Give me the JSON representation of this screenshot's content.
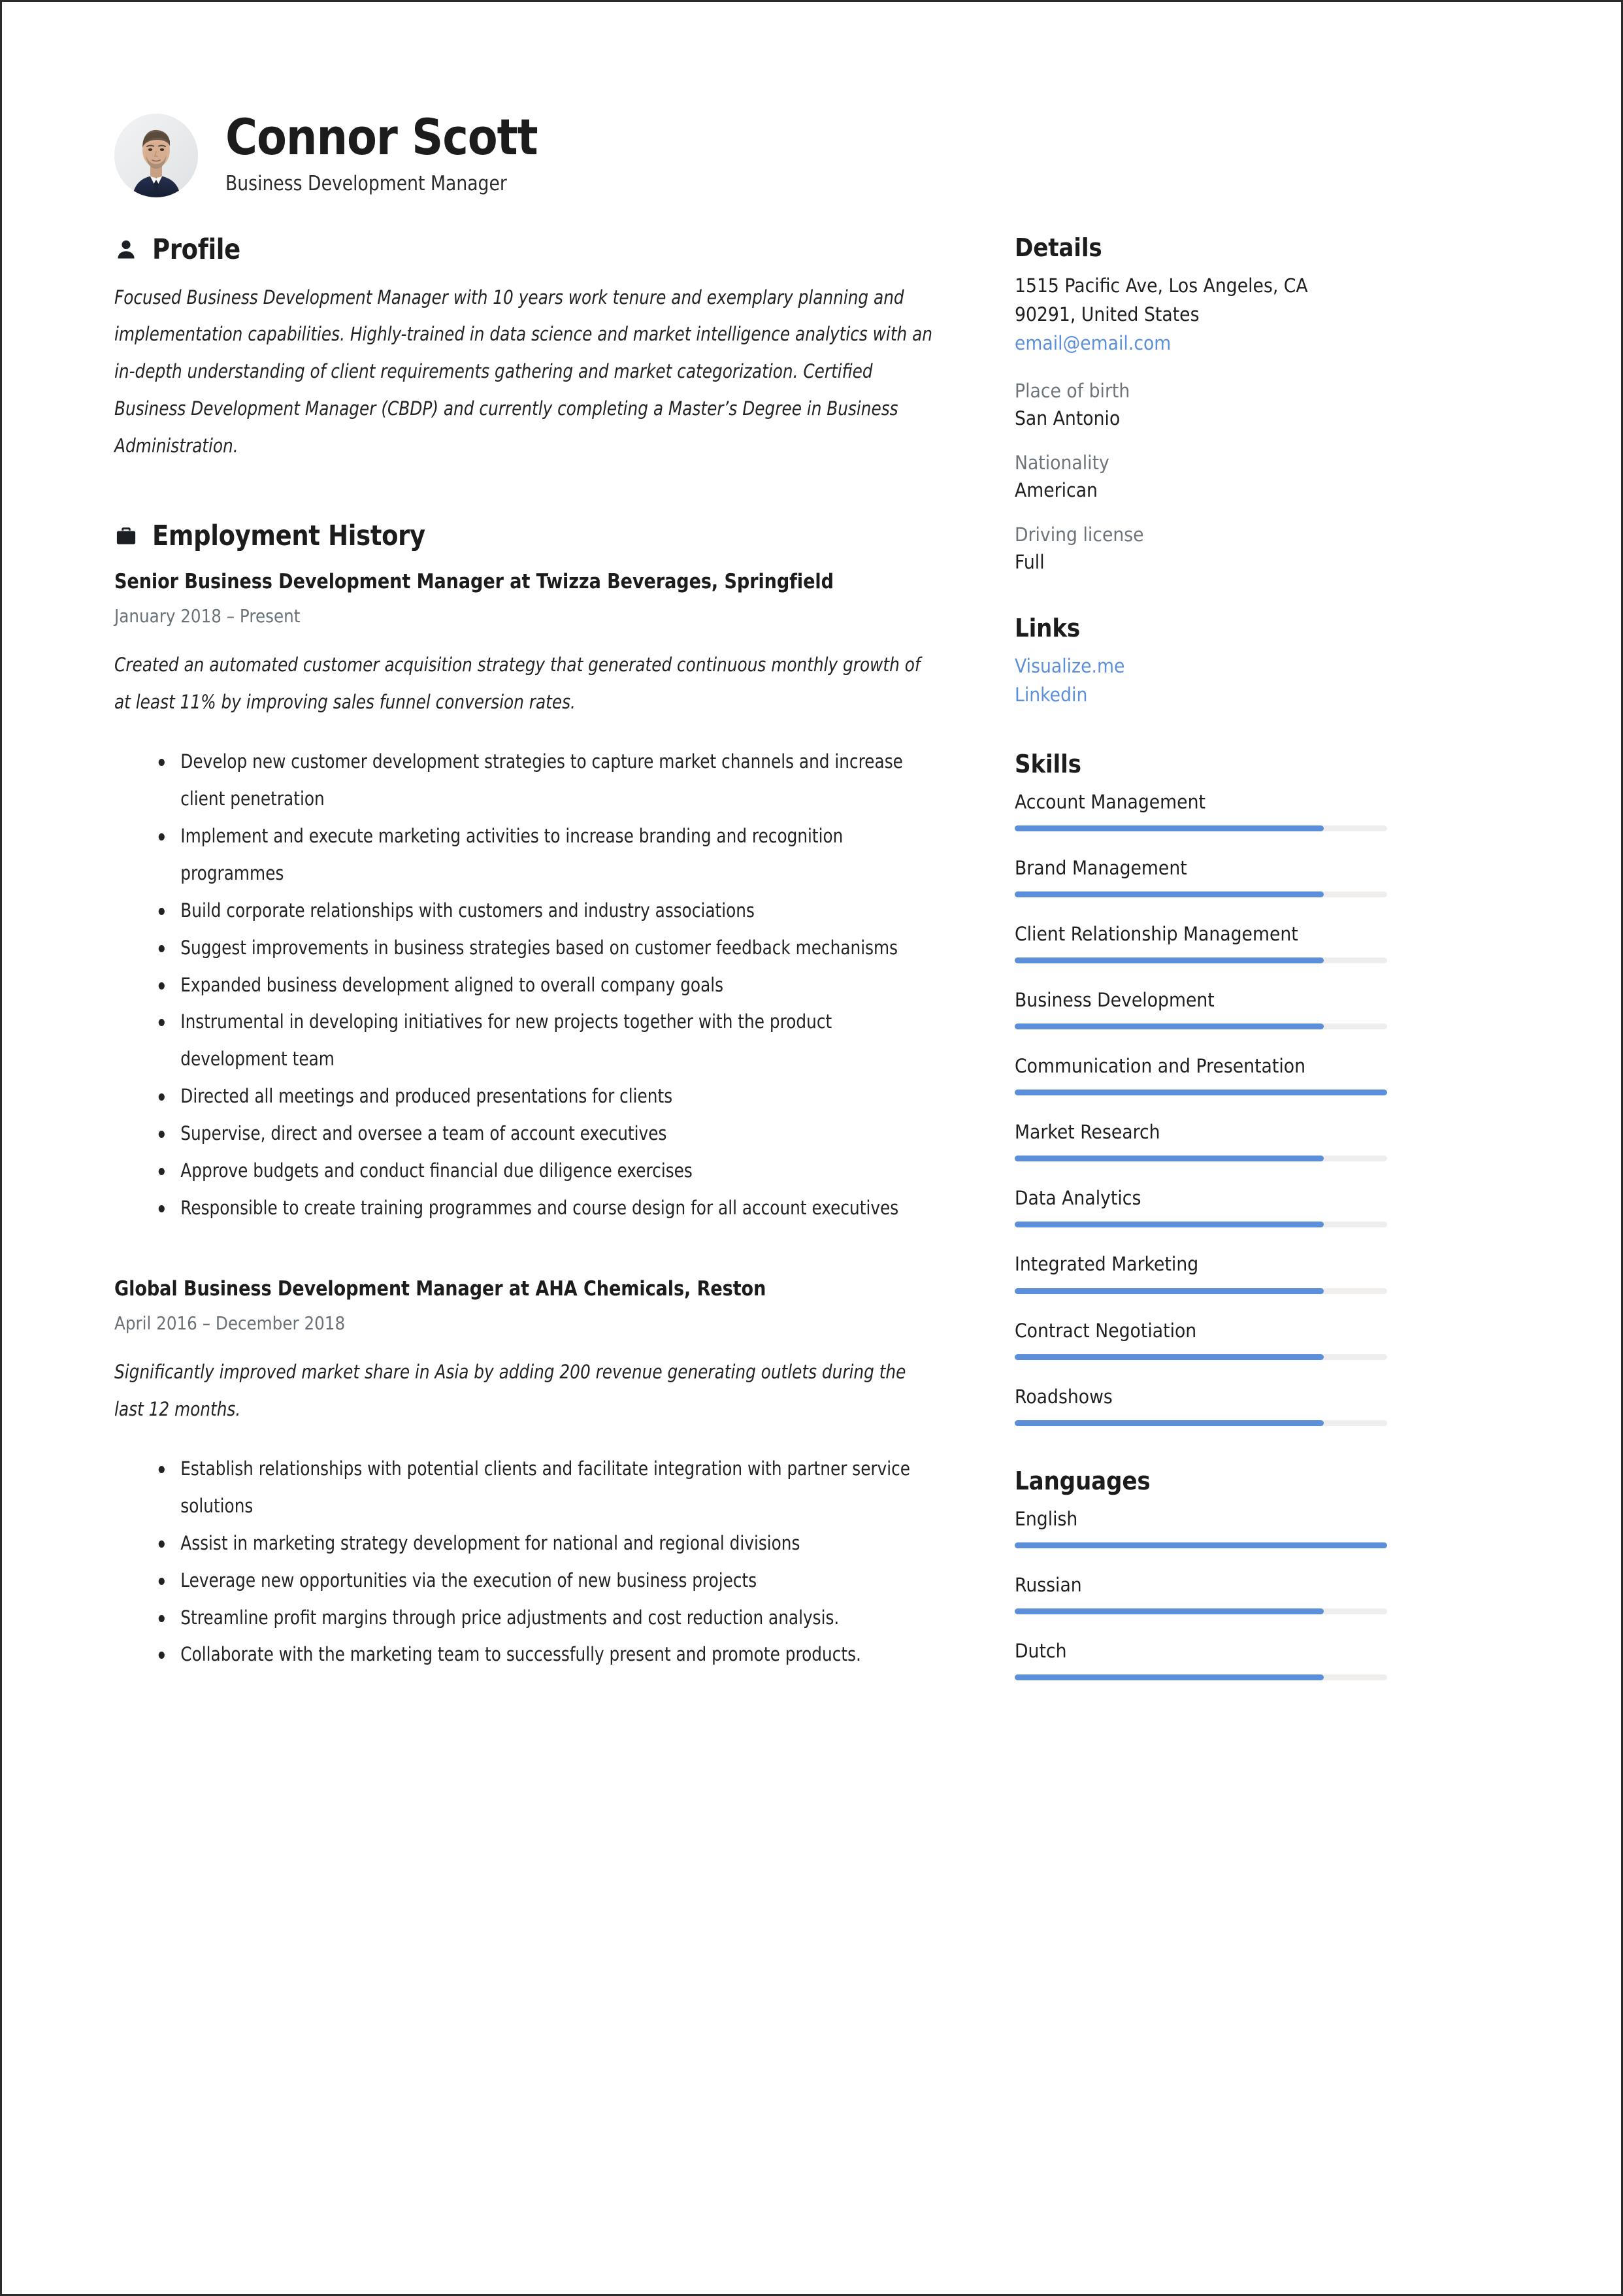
{
  "header": {
    "name": "Connor Scott",
    "job_title": "Business Development Manager",
    "avatar_alt": "profile-photo"
  },
  "profile": {
    "section_title": "Profile",
    "icon": "person-icon",
    "text": "Focused Business Development Manager with 10 years work tenure and exemplary planning and implementation capabilities. Highly-trained in data science and market intelligence analytics with an in-depth understanding of client requirements gathering and market categorization. Certified Business Development Manager (CBDP) and currently completing a Master’s Degree in Business Administration."
  },
  "employment": {
    "section_title": "Employment History",
    "icon": "briefcase-icon",
    "jobs": [
      {
        "role": "Senior Business Development Manager at Twizza Beverages, Springfield",
        "dates": "January 2018  –  Present",
        "summary": "Created an automated customer acquisition strategy that generated continuous monthly growth of at least 11% by improving sales funnel conversion rates.",
        "bullets": [
          "Develop new customer development strategies to capture market channels and increase client penetration",
          "Implement and execute marketing activities to increase branding and recognition programmes",
          "Build corporate relationships with customers and industry associations",
          "Suggest improvements in business strategies based on customer feedback mechanisms",
          "Expanded business development aligned to overall company goals",
          "Instrumental in developing initiatives for new projects together with the product development team",
          "Directed all meetings and produced presentations for clients",
          "Supervise, direct and oversee a team of account executives",
          "Approve budgets and conduct financial due diligence exercises",
          "Responsible to create training programmes and course design for all account executives"
        ]
      },
      {
        "role": "Global Business Development Manager at AHA Chemicals, Reston",
        "dates": "April 2016  –  December 2018",
        "summary": "Significantly improved market share in Asia by adding 200 revenue generating outlets during the last 12 months.",
        "bullets": [
          "Establish relationships with potential clients and facilitate integration with partner service solutions",
          "Assist in marketing strategy development for national and regional divisions",
          "Leverage new opportunities via the execution of new business projects",
          "Streamline profit margins through price adjustments and cost reduction analysis.",
          "Collaborate with the marketing team to successfully present and promote products."
        ]
      }
    ]
  },
  "details": {
    "section_title": "Details",
    "address_line1": "1515 Pacific Ave, Los Angeles, CA",
    "address_line2": "90291, United States",
    "email": "email@email.com",
    "fields": [
      {
        "label": "Place of birth",
        "value": "San Antonio"
      },
      {
        "label": "Nationality",
        "value": "American"
      },
      {
        "label": "Driving license",
        "value": "Full"
      }
    ]
  },
  "links": {
    "section_title": "Links",
    "items": [
      {
        "label": "Visualize.me"
      },
      {
        "label": "Linkedin"
      }
    ]
  },
  "skills": {
    "section_title": "Skills",
    "items": [
      {
        "label": "Account Management",
        "level": 83
      },
      {
        "label": "Brand Management",
        "level": 83
      },
      {
        "label": "Client Relationship Management",
        "level": 83
      },
      {
        "label": "Business Development",
        "level": 83
      },
      {
        "label": "Communication and Presentation",
        "level": 100
      },
      {
        "label": "Market Research",
        "level": 83
      },
      {
        "label": "Data Analytics",
        "level": 83
      },
      {
        "label": "Integrated Marketing",
        "level": 83
      },
      {
        "label": "Contract Negotiation",
        "level": 83
      },
      {
        "label": "Roadshows",
        "level": 83
      }
    ]
  },
  "languages": {
    "section_title": "Languages",
    "items": [
      {
        "label": "English",
        "level": 100
      },
      {
        "label": "Russian",
        "level": 83
      },
      {
        "label": "Dutch",
        "level": 83
      }
    ]
  },
  "colors": {
    "accent_blue": "#5b8fdb",
    "bar_track": "#efeeec",
    "text_dark": "#1c1c1c",
    "text_muted": "#6d757b"
  }
}
